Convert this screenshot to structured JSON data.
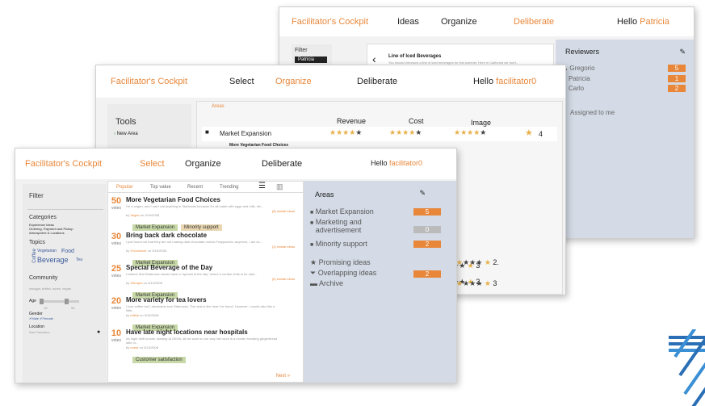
{
  "back": {
    "app": "Facilitator's Cockpit",
    "nav": [
      "Ideas",
      "Organize",
      "Deliberate"
    ],
    "hello": "Hello",
    "user": "Patricia",
    "filter": "Filter",
    "filter_item": "Patricia",
    "idea_title": "Line of Iced Beverages",
    "idea_desc": "You should introduce a line of iced beverages for this summer. Here in California we don't...",
    "reviewers_title": "Reviewers",
    "reviewers": [
      {
        "name": "Gregorio",
        "count": "5"
      },
      {
        "name": "Patricia",
        "count": "1"
      },
      {
        "name": "Carlo",
        "count": "2"
      }
    ],
    "assigned": "Assigned to me"
  },
  "mid": {
    "app": "Facilitator's Cockpit",
    "nav": [
      "Select",
      "Organize",
      "Deliberate"
    ],
    "hello": "Hello",
    "user": "facilitator0",
    "tools": "Tools",
    "new_area": "New Area",
    "areas_tab": "Areas",
    "columns": [
      "Revenue",
      "Cost",
      "Image"
    ],
    "area": "Market Expansion",
    "sub_idea": "More Vegetarian Food Choices",
    "sub_desc": "I'm a vegan, and I can't eat anything in Starbucks because...",
    "sub_votes": "50",
    "scores": [
      "4",
      "3",
      "3.",
      "2.",
      "3"
    ]
  },
  "front": {
    "app": "Facilitator's Cockpit",
    "nav": [
      "Select",
      "Organize",
      "Deliberate"
    ],
    "hello": "Hello",
    "user": "facilitator0",
    "filter": "Filter",
    "categories": "Categories",
    "category_items": [
      "Experience Ideas",
      "Ordering, Payment and Pickup",
      "Atmosphere & Locations"
    ],
    "topics": "Topics",
    "topic_words": [
      "Coffee",
      "Vegetarian",
      "Food",
      "Beverage",
      "Tea"
    ],
    "community": "Community",
    "community_hint": "vinogya, british, nurse, vegan",
    "age": "Age",
    "age_min": "18",
    "age_max": "58",
    "gender": "Gender",
    "gender_options": [
      "Male",
      "Female"
    ],
    "location": "Location",
    "location_value": "San Francisco",
    "tabs": [
      "Popular",
      "Top value",
      "Recent",
      "Trending"
    ],
    "ideas": [
      {
        "votes": "50",
        "title": "More Vegetarian Food Choices",
        "desc": "I'm a vegan, and I can't eat anything in Starbucks because it's all made with eggs and milk, etc...",
        "by": "by",
        "author": "Vegan",
        "date": "on 3/19/2008",
        "similar": "(8) similar ideas",
        "tags": [
          "Market Expansion",
          "Minority support"
        ]
      },
      {
        "votes": "30",
        "title": "Bring back dark chocolate",
        "desc": "I just found out that they are not making dark chocolate mocha Frappuccino anymore, I am so...",
        "by": "by",
        "author": "Chocolover",
        "date": "on 3/19/2008",
        "similar": "(3) similar ideas",
        "tags": [
          "Market Expansion"
        ]
      },
      {
        "votes": "25",
        "title": "Special Beverage of the Day",
        "desc": "I believe that Starbucks should have a \"special of the day\" where a certain drink is for sale...",
        "by": "by",
        "author": "Vbndpro",
        "date": "on 3/19/2008",
        "similar": "(5) similar ideas",
        "tags": [
          "Market Expansion"
        ]
      },
      {
        "votes": "20",
        "title": "More variety for tea lovers",
        "desc": "I love coffee but I absolutely love Starbucks. The chai is like heat I've found. However, I would also like a little...",
        "by": "by",
        "author": "british",
        "date": "on 3/19/2008",
        "similar": "",
        "tags": [
          "Market Expansion"
        ]
      },
      {
        "votes": "10",
        "title": "Have late night locations near hospitals",
        "desc": "As night shift nurses, starting at 2300h, all we want on our way into work is a morale boosting gingerbread latte or...",
        "by": "by",
        "author": "nurse",
        "date": "on 3/19/2008",
        "similar": "",
        "tags": [
          "Customer satisfaction"
        ]
      }
    ],
    "votes_label": "votes",
    "next": "Next »",
    "areas_title": "Areas",
    "areas": [
      {
        "name": "Market Expansion",
        "count": "5"
      },
      {
        "name": "Marketing and advertisement",
        "count": "0"
      },
      {
        "name": "Minority support",
        "count": "2"
      }
    ],
    "filters": [
      {
        "name": "Promising ideas",
        "count": ""
      },
      {
        "name": "Overlapping ideas",
        "count": "2"
      },
      {
        "name": "Archive",
        "count": ""
      }
    ]
  },
  "colors": {
    "accent": "#e8873a",
    "sidebar_blue": "#d4dbe6"
  }
}
